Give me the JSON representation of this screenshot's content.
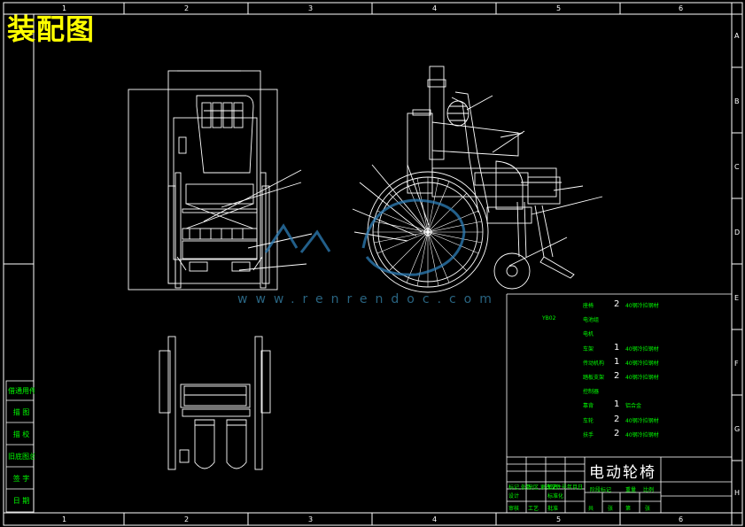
{
  "title": "装配图",
  "watermark": "www.renrendoc.com",
  "title_block": {
    "name": "电动轮椅",
    "cells": [
      "标记 处数",
      "分区 更改文件号",
      "签名",
      "年月日",
      "设计",
      "标准化",
      "审核",
      "工艺",
      "批准",
      "阶段标记",
      "重量",
      "比例",
      "共",
      "张",
      "第",
      "张"
    ]
  },
  "grid": {
    "columns": [
      "1",
      "2",
      "3",
      "4",
      "5",
      "6"
    ],
    "rows": [
      "A",
      "B",
      "C",
      "D",
      "E",
      "F",
      "G",
      "H"
    ]
  },
  "side_cells": [
    "借通用件登记",
    "描 图",
    "描 校",
    "旧底图总号",
    "签 字",
    "日 期"
  ],
  "bom": {
    "rows": [
      {
        "name": "座椅",
        "qty": "2",
        "material": "40钢冷拉钢材"
      },
      {
        "name": "电池组",
        "qty": "",
        "material": ""
      },
      {
        "name": "电机",
        "qty": "",
        "material": ""
      },
      {
        "name": "车架",
        "qty": "1",
        "material": "40钢冷拉钢材"
      },
      {
        "name": "传动机构",
        "qty": "1",
        "material": "40钢冷拉钢材"
      },
      {
        "name": "踏板支架",
        "qty": "2",
        "material": "40钢冷拉钢材"
      },
      {
        "name": "控制器",
        "qty": "",
        "material": ""
      },
      {
        "name": "靠背",
        "qty": "1",
        "material": "铝合金"
      },
      {
        "name": "车轮",
        "qty": "2",
        "material": "40钢冷拉钢材"
      },
      {
        "name": "扶手",
        "qty": "2",
        "material": "40钢冷拉钢材"
      }
    ],
    "left_label": "YB02"
  },
  "colors": {
    "frame": "#ffffff",
    "parts": "#ffffff",
    "text_green": "#00ff00",
    "title_yellow": "#ffff00",
    "wheel_blue": "#2e7fb8"
  }
}
